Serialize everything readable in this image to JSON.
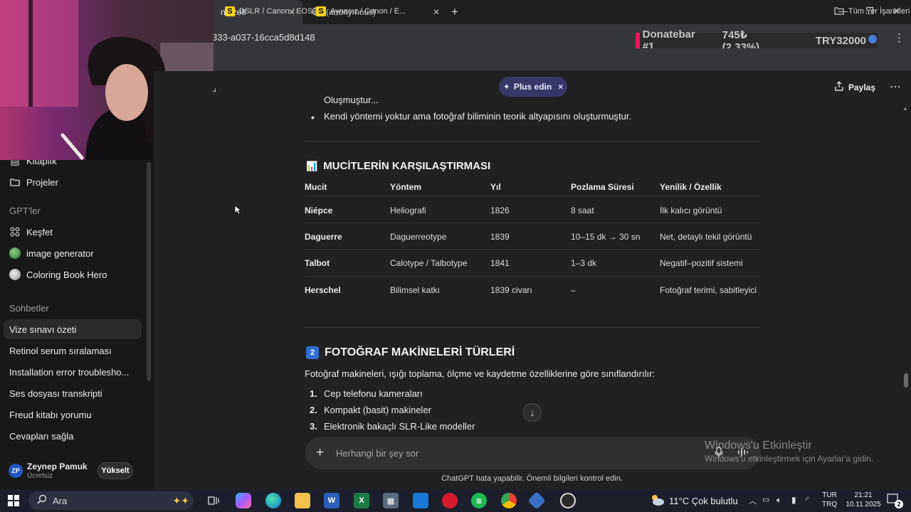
{
  "browser": {
    "tab_active": "n özeti",
    "tab_second": "(anonymous)",
    "new_tab": "+",
    "url_fragment": "333-a037-16cca5d8d148",
    "bookmarks": [
      {
        "label": "DSLR / Canon / EOS..."
      },
      {
        "label": "Aynasız / Canon / E..."
      }
    ],
    "all_bookmarks": "Tüm Yer İşaretleri",
    "window_controls": {
      "minimize": "—",
      "restore": "❐",
      "close": "✕"
    }
  },
  "overlay": {
    "donate_label": "Donatebar #1",
    "donate_value": "745₺ (2.33%)",
    "donate_goal": "TRY32000"
  },
  "sidebar": {
    "items_top": [
      {
        "label": "Kitaplık",
        "icon": "library-icon"
      },
      {
        "label": "Projeler",
        "icon": "folder-icon"
      }
    ],
    "gpts_header": "GPT'ler",
    "gpts": [
      {
        "label": "Keşfet",
        "icon": "grid-icon"
      },
      {
        "label": "image generator",
        "icon": "gpt-avatar"
      },
      {
        "label": "Coloring Book Hero",
        "icon": "gpt-avatar"
      }
    ],
    "chats_header": "Sohbetler",
    "chats": [
      {
        "label": "Vize sınavı özeti",
        "active": true
      },
      {
        "label": "Retinol serum sıralaması"
      },
      {
        "label": "Installation error troublesho..."
      },
      {
        "label": "Ses dosyası transkripti"
      },
      {
        "label": "Freud kitabı yorumu"
      },
      {
        "label": "Cevapları sağla"
      }
    ],
    "user": {
      "initials": "ZP",
      "name": "Zeynep Pamuk",
      "plan": "Ücretsiz",
      "upgrade": "Yükselt"
    }
  },
  "header": {
    "plus_label": "Plus edin",
    "plus_close": "×",
    "share_label": "Paylaş",
    "more": "⋯"
  },
  "content": {
    "partial_bullet": "Oluşmuştur...",
    "bullet": "Kendi yöntemi yoktur ama fotoğraf biliminin teorik altyapısını oluşturmuştur.",
    "section1_icon": "📊",
    "section1_title": "MUCİTLERİN KARŞILAŞTIRMASI",
    "table": {
      "headers": [
        "Mucit",
        "Yöntem",
        "Yıl",
        "Pozlama Süresi",
        "Yenilik / Özellik"
      ],
      "rows": [
        [
          "Niépce",
          "Heliografi",
          "1826",
          "8 saat",
          "İlk kalıcı görüntü"
        ],
        [
          "Daguerre",
          "Daguerreotype",
          "1839",
          "10–15 dk → 30 sn",
          "Net, detaylı tekil görüntü"
        ],
        [
          "Talbot",
          "Calotype / Talbotype",
          "1841",
          "1–3 dk",
          "Negatif–pozitif sistemi"
        ],
        [
          "Herschel",
          "Bilimsel katkı",
          "1839 civarı",
          "–",
          "Fotoğraf terimi, sabitleyici"
        ]
      ]
    },
    "section2_num": "2",
    "section2_title": "FOTOĞRAF MAKİNELERİ TÜRLERİ",
    "section2_intro": "Fotoğraf makineleri, ışığı toplama, ölçme ve kaydetme özelliklerine göre sınıflandırılır:",
    "list": [
      {
        "n": "1.",
        "text": "Cep telefonu kameraları"
      },
      {
        "n": "2.",
        "text": "Kompakt (basit) makineler"
      },
      {
        "n": "3.",
        "text": "Elektronik bakaçlı SLR-Like modeller"
      }
    ]
  },
  "composer": {
    "placeholder": "Herhangi bir şey sor",
    "plus": "+"
  },
  "disclaimer": "ChatGPT hata yapabilir. Önemli bilgileri kontrol edin.",
  "activation": {
    "title": "Windows'u Etkinleştir",
    "subtitle": "Windows'u etkinleştirmek için Ayarlar'a gidin."
  },
  "taskbar": {
    "search": "Ara",
    "weather": "11°C  Çok bulutlu",
    "lang_top": "TUR",
    "lang_bottom": "TRQ",
    "time": "21:21",
    "date": "10.11.2025",
    "notif_count": "2"
  },
  "colors": {
    "bg": "#212121",
    "sidebar": "#181818",
    "accent_plus": "#373669",
    "donate_pink": "#e6195d"
  }
}
